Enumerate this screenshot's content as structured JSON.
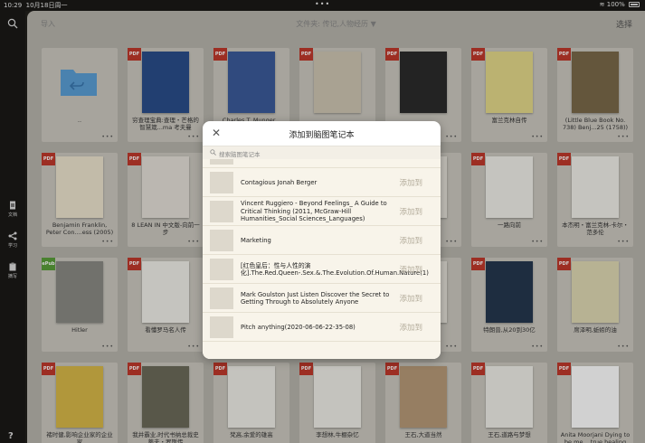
{
  "status": {
    "time": "10:29",
    "date": "10月18日周一",
    "dots": "•••",
    "battery": "100%"
  },
  "rail": {
    "items": [
      {
        "label": "文档",
        "icon": "document-icon"
      },
      {
        "label": "学习",
        "icon": "mindmap-icon"
      },
      {
        "label": "摘写",
        "icon": "clipboard-icon"
      }
    ],
    "help": "?"
  },
  "topbar": {
    "import": "导入",
    "folder": "文件夹: 传记,人物经历 ▼",
    "select": "选择"
  },
  "books": [
    {
      "title": "..",
      "badge": "",
      "cover": "#d7d3c8"
    },
    {
      "title": "穷查理宝典:查理・芒格的智慧箴...ma 考夫曼",
      "badge": "PDF",
      "cover": "#2a4e8a"
    },
    {
      "title": "Charles T. Munger...",
      "badge": "PDF",
      "cover": "#3b5b9a"
    },
    {
      "title": "",
      "badge": "PDF",
      "cover": "#cfc6b2"
    },
    {
      "title": "",
      "badge": "PDF",
      "cover": "#2b2b2b"
    },
    {
      "title": "富兰克林自传",
      "badge": "PDF",
      "cover": "#e4d98a"
    },
    {
      "title": "(Little Blue Book No. 738) Benj...25 (1758))",
      "badge": "PDF",
      "cover": "#7a6a4a"
    },
    {
      "title": "Benjamin Franklin, Peter Con....ess (2005)",
      "badge": "PDF",
      "cover": "#ede4cf"
    },
    {
      "title": "8 LEAN IN 中文版-向前一步",
      "badge": "PDF",
      "cover": "#e5e0d8"
    },
    {
      "title": "",
      "badge": "PDF",
      "cover": "#e8e4dc"
    },
    {
      "title": "",
      "badge": "PDF",
      "cover": "#e8e4dc"
    },
    {
      "title": "",
      "badge": "PDF",
      "cover": "#e8e4dc"
    },
    {
      "title": "一路向前",
      "badge": "PDF",
      "cover": "#f1efe9"
    },
    {
      "title": "本杰明・富兰克林-卡尔・范多伦",
      "badge": "PDF",
      "cover": "#f1efe9"
    },
    {
      "title": "Hitler",
      "badge": "ePub",
      "cover": "#8a8a84"
    },
    {
      "title": "看懂罗马名人传",
      "badge": "PDF",
      "cover": "#f1efe9"
    },
    {
      "title": "",
      "badge": "PDF",
      "cover": "#e8e4dc"
    },
    {
      "title": "",
      "badge": "PDF",
      "cover": "#e8e4dc"
    },
    {
      "title": "",
      "badge": "PDF",
      "cover": "#e8e4dc"
    },
    {
      "title": "特朗普,从20到30亿",
      "badge": "PDF",
      "cover": "#25374f"
    },
    {
      "title": "席泽明,蚯蚓的油",
      "badge": "PDF",
      "cover": "#e0d9b4"
    },
    {
      "title": "褚时健,影响企业家的企业家",
      "badge": "PDF",
      "cover": "#d8b948"
    },
    {
      "title": "我并霸业,时代书纳总裁史蒂夫・罗斯传",
      "badge": "PDF",
      "cover": "#6c6b5a"
    },
    {
      "title": "梵高,余爱的雄高",
      "badge": "PDF",
      "cover": "#f0eee8"
    },
    {
      "title": "李想林,牛棚杂忆",
      "badge": "PDF",
      "cover": "#f0eee8"
    },
    {
      "title": "王石,大道当然",
      "badge": "PDF",
      "cover": "#b89a78"
    },
    {
      "title": "王石,道路与梦想",
      "badge": "PDF",
      "cover": "#f0eee8"
    },
    {
      "title": "Anita Moorjani Dying to be me....true healing",
      "badge": "PDF",
      "cover": "#ffffff"
    }
  ],
  "modal": {
    "title": "添加到脑图笔记本",
    "close": "✕",
    "search_placeholder": "搜索脑图笔记本",
    "add_label": "添加到",
    "items": [
      {
        "name": "Contagious Jonah Berger"
      },
      {
        "name": "Vincent Ruggiero - Beyond Feelings_ A Guide to Critical Thinking (2011, McGraw-Hill Humanities_Social Sciences_Languages)"
      },
      {
        "name": "Marketing"
      },
      {
        "name": "[红色皇后：性与人性的演化].The.Red.Queen-.Sex.&.The.Evolution.Of.Human.Nature(1)"
      },
      {
        "name": "Mark Goulston Just Listen Discover the Secret to Getting Through to Absolutely Anyone"
      },
      {
        "name": "Pitch anything(2020-06-06-22-35-08)"
      }
    ]
  }
}
